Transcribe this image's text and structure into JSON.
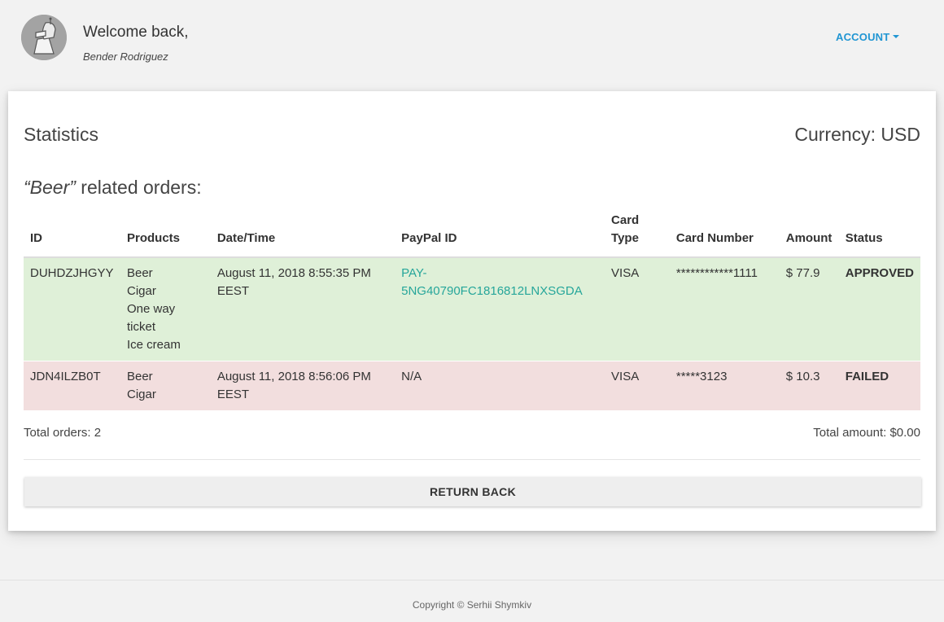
{
  "header": {
    "welcome": "Welcome back,",
    "username": "Bender Rodriguez",
    "account_label": "ACCOUNT"
  },
  "main": {
    "title": "Statistics",
    "currency": "Currency: USD",
    "related_keyword": "“Beer”",
    "related_suffix": " related orders:"
  },
  "table": {
    "headers": [
      "ID",
      "Products",
      "Date/Time",
      "PayPal ID",
      "Card Type",
      "Card Number",
      "Amount",
      "Status"
    ],
    "rows": [
      {
        "id": "DUHDZJHGYY",
        "products": [
          "Beer",
          "Cigar",
          "One way",
          "ticket",
          "Ice cream"
        ],
        "date_line1": "August 11, 2018 8:55:35 PM",
        "date_line2": "EEST",
        "paypal_line1": "PAY-",
        "paypal_line2": "5NG40790FC1816812LNXSGDA",
        "card_type": "VISA",
        "card_number": "************1111",
        "amount": "$ 77.9",
        "status": "APPROVED",
        "row_color": "#dff0d8"
      },
      {
        "id": "JDN4ILZB0T",
        "products": [
          "Beer",
          "Cigar"
        ],
        "date_line1": "August 11, 2018 8:56:06 PM",
        "date_line2": "EEST",
        "paypal": "N/A",
        "card_type": "VISA",
        "card_number": "*****3123",
        "amount": "$ 10.3",
        "status": "FAILED",
        "row_color": "#f2dede"
      }
    ]
  },
  "summary": {
    "total_orders": "Total orders: 2",
    "total_amount": "Total amount: $0.00"
  },
  "return_button": "RETURN BACK",
  "footer": "Copyright © Serhii Shymkiv",
  "colors": {
    "accent": "#2196d3",
    "link": "#26a69a",
    "approved_bg": "#dff0d8",
    "failed_bg": "#f2dede"
  },
  "icons": {
    "avatar": "user-avatar-icon",
    "dropdown": "caret-down-icon"
  }
}
